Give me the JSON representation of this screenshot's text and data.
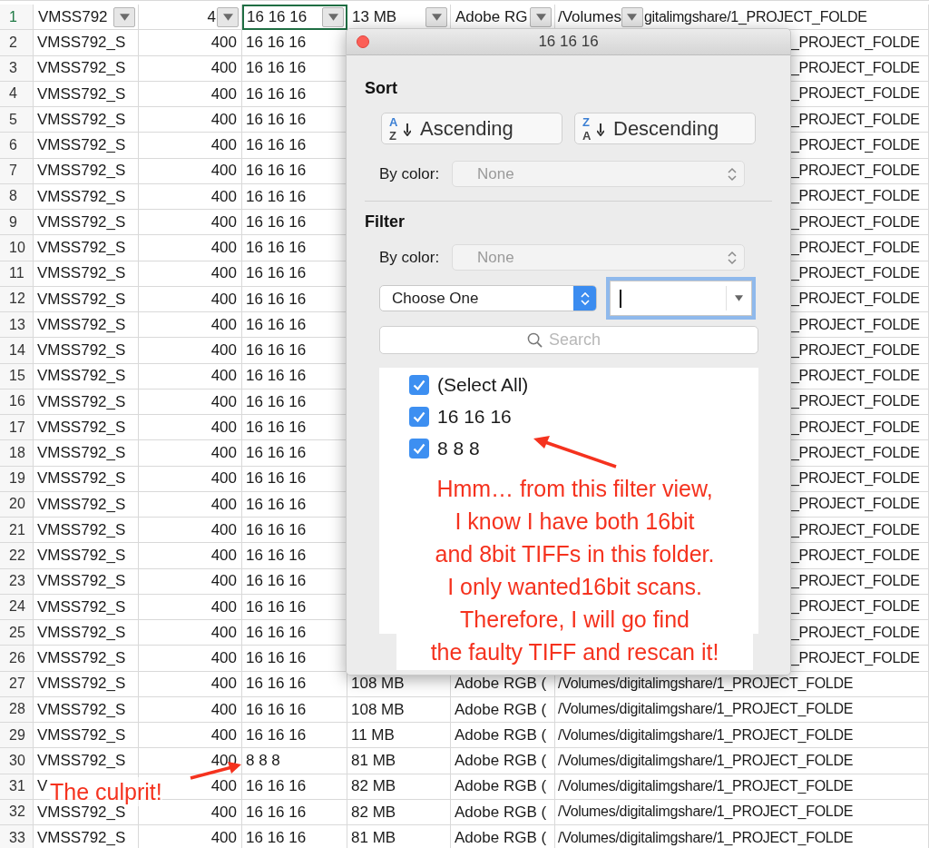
{
  "sheet": {
    "rows": [
      {
        "num": "1",
        "kind": "header",
        "selected": true,
        "a": "VMSS792",
        "b": "4",
        "c": "16 16 16",
        "d": "13 MB",
        "e": "Adobe RG",
        "f": "/Volumes",
        "f_tail": "gitalimgshare/1_PROJECT_FOLDE"
      },
      {
        "num": "2",
        "kind": "data",
        "selected": false,
        "a": "VMSS792_S",
        "b": "400",
        "c": "16 16 16",
        "f": "_PROJECT_FOLDE"
      },
      {
        "num": "3",
        "kind": "data",
        "selected": false,
        "a": "VMSS792_S",
        "b": "400",
        "c": "16 16 16",
        "f": "_PROJECT_FOLDE"
      },
      {
        "num": "4",
        "kind": "data",
        "selected": false,
        "a": "VMSS792_S",
        "b": "400",
        "c": "16 16 16",
        "f": "_PROJECT_FOLDE"
      },
      {
        "num": "5",
        "kind": "data",
        "selected": false,
        "a": "VMSS792_S",
        "b": "400",
        "c": "16 16 16",
        "f": "_PROJECT_FOLDE"
      },
      {
        "num": "6",
        "kind": "data",
        "selected": false,
        "a": "VMSS792_S",
        "b": "400",
        "c": "16 16 16",
        "f": "_PROJECT_FOLDE"
      },
      {
        "num": "7",
        "kind": "data",
        "selected": false,
        "a": "VMSS792_S",
        "b": "400",
        "c": "16 16 16",
        "f": "_PROJECT_FOLDE"
      },
      {
        "num": "8",
        "kind": "data",
        "selected": false,
        "a": "VMSS792_S",
        "b": "400",
        "c": "16 16 16",
        "f": "_PROJECT_FOLDE"
      },
      {
        "num": "9",
        "kind": "data",
        "selected": false,
        "a": "VMSS792_S",
        "b": "400",
        "c": "16 16 16",
        "f": "_PROJECT_FOLDE"
      },
      {
        "num": "10",
        "kind": "data",
        "selected": false,
        "a": "VMSS792_S",
        "b": "400",
        "c": "16 16 16",
        "f": "_PROJECT_FOLDE"
      },
      {
        "num": "11",
        "kind": "data",
        "selected": false,
        "a": "VMSS792_S",
        "b": "400",
        "c": "16 16 16",
        "f": "_PROJECT_FOLDE"
      },
      {
        "num": "12",
        "kind": "data",
        "selected": false,
        "a": "VMSS792_S",
        "b": "400",
        "c": "16 16 16",
        "f": "_PROJECT_FOLDE"
      },
      {
        "num": "13",
        "kind": "data",
        "selected": false,
        "a": "VMSS792_S",
        "b": "400",
        "c": "16 16 16",
        "f": "_PROJECT_FOLDE"
      },
      {
        "num": "14",
        "kind": "data",
        "selected": false,
        "a": "VMSS792_S",
        "b": "400",
        "c": "16 16 16",
        "f": "_PROJECT_FOLDE"
      },
      {
        "num": "15",
        "kind": "data",
        "selected": false,
        "a": "VMSS792_S",
        "b": "400",
        "c": "16 16 16",
        "f": "_PROJECT_FOLDE"
      },
      {
        "num": "16",
        "kind": "data",
        "selected": false,
        "a": "VMSS792_S",
        "b": "400",
        "c": "16 16 16",
        "f": "_PROJECT_FOLDE"
      },
      {
        "num": "17",
        "kind": "data",
        "selected": false,
        "a": "VMSS792_S",
        "b": "400",
        "c": "16 16 16",
        "f": "_PROJECT_FOLDE"
      },
      {
        "num": "18",
        "kind": "data",
        "selected": false,
        "a": "VMSS792_S",
        "b": "400",
        "c": "16 16 16",
        "f": "_PROJECT_FOLDE"
      },
      {
        "num": "19",
        "kind": "data",
        "selected": false,
        "a": "VMSS792_S",
        "b": "400",
        "c": "16 16 16",
        "f": "_PROJECT_FOLDE"
      },
      {
        "num": "20",
        "kind": "data",
        "selected": false,
        "a": "VMSS792_S",
        "b": "400",
        "c": "16 16 16",
        "f": "_PROJECT_FOLDE"
      },
      {
        "num": "21",
        "kind": "data",
        "selected": false,
        "a": "VMSS792_S",
        "b": "400",
        "c": "16 16 16",
        "f": "_PROJECT_FOLDE"
      },
      {
        "num": "22",
        "kind": "data",
        "selected": false,
        "a": "VMSS792_S",
        "b": "400",
        "c": "16 16 16",
        "f": "_PROJECT_FOLDE"
      },
      {
        "num": "23",
        "kind": "data",
        "selected": false,
        "a": "VMSS792_S",
        "b": "400",
        "c": "16 16 16",
        "f": "_PROJECT_FOLDE"
      },
      {
        "num": "24",
        "kind": "data",
        "selected": false,
        "a": "VMSS792_S",
        "b": "400",
        "c": "16 16 16",
        "f": "_PROJECT_FOLDE"
      },
      {
        "num": "25",
        "kind": "data",
        "selected": false,
        "a": "VMSS792_S",
        "b": "400",
        "c": "16 16 16",
        "f": "_PROJECT_FOLDE"
      },
      {
        "num": "26",
        "kind": "data",
        "selected": false,
        "a": "VMSS792_S",
        "b": "400",
        "c": "16 16 16",
        "f": "_PROJECT_FOLDE"
      },
      {
        "num": "27",
        "kind": "data",
        "selected": false,
        "a": "VMSS792_S",
        "b": "400",
        "c": "16 16 16",
        "d": "108 MB",
        "e": "Adobe RGB (",
        "f": "/Volumes/digitalimgshare/1_PROJECT_FOLDE"
      },
      {
        "num": "28",
        "kind": "data",
        "selected": false,
        "a": "VMSS792_S",
        "b": "400",
        "c": "16 16 16",
        "d": "108 MB",
        "e": "Adobe RGB (",
        "f": "/Volumes/digitalimgshare/1_PROJECT_FOLDE"
      },
      {
        "num": "29",
        "kind": "data",
        "selected": false,
        "a": "VMSS792_S",
        "b": "400",
        "c": "16 16 16",
        "d": "11 MB",
        "e": "Adobe RGB (",
        "f": "/Volumes/digitalimgshare/1_PROJECT_FOLDE"
      },
      {
        "num": "30",
        "kind": "data",
        "selected": false,
        "a": "VMSS792_S",
        "b": "400",
        "c": "8 8 8",
        "d": "81 MB",
        "e": "Adobe RGB (",
        "f": "/Volumes/digitalimgshare/1_PROJECT_FOLDE"
      },
      {
        "num": "31",
        "kind": "data",
        "selected": false,
        "a": "V",
        "b": "400",
        "c": "16 16 16",
        "d": "82 MB",
        "e": "Adobe RGB (",
        "f": "/Volumes/digitalimgshare/1_PROJECT_FOLDE"
      },
      {
        "num": "32",
        "kind": "data",
        "selected": false,
        "a": "VMSS792_S",
        "b": "400",
        "c": "16 16 16",
        "d": "82 MB",
        "e": "Adobe RGB (",
        "f": "/Volumes/digitalimgshare/1_PROJECT_FOLDE"
      },
      {
        "num": "33",
        "kind": "data",
        "selected": false,
        "a": "VMSS792_S",
        "b": "400",
        "c": "16 16 16",
        "d": "81 MB",
        "e": "Adobe RGB (",
        "f": "/Volumes/digitalimgshare/1_PROJECT_FOLDE"
      }
    ]
  },
  "filter_popup": {
    "title": "16 16 16",
    "sort": {
      "heading": "Sort",
      "buttons": [
        {
          "label": "Ascending",
          "icon_top": "A",
          "icon_bottom": "Z"
        },
        {
          "label": "Descending",
          "icon_top": "Z",
          "icon_bottom": "A"
        }
      ],
      "by_color": {
        "label": "By color:",
        "value": "None",
        "disabled": true
      }
    },
    "filter": {
      "heading": "Filter",
      "by_color": {
        "label": "By color:",
        "value": "None",
        "disabled": true
      },
      "condition": {
        "value": "Choose One"
      },
      "criteria": {
        "focused": true
      },
      "search": {
        "placeholder": "Search"
      },
      "items": [
        {
          "label": "(Select All)",
          "checked": true
        },
        {
          "label": "16 16 16",
          "checked": true
        },
        {
          "label": "8 8 8",
          "checked": true
        }
      ]
    }
  },
  "annotations": {
    "note": [
      "Hmm… from this filter view,",
      "I know I have both 16bit",
      "and 8bit TIFFs in this folder.",
      "I only wanted16bit scans.",
      "Therefore, I will go find",
      "the faulty TIFF and rescan it!"
    ],
    "culprit": "The culprit!"
  }
}
